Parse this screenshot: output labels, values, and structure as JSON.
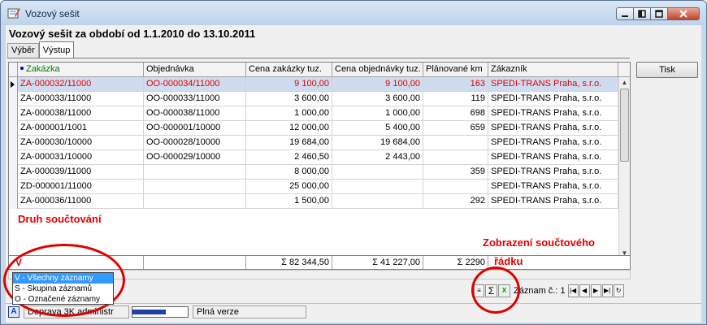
{
  "window": {
    "title": "Vozový sešit",
    "heading": "Vozový sešit za období od 1.1.2010 do 13.10.2011"
  },
  "tabs": [
    {
      "label": "Výběr",
      "active": false
    },
    {
      "label": "Výstup",
      "active": true
    }
  ],
  "grid": {
    "columns": [
      "Zakázka",
      "Objednávka",
      "Cena zakázky tuz.",
      "Cena objednávky tuz.",
      "Plánované km",
      "Zákazník"
    ],
    "rows": [
      {
        "zakazka": "ZA-000032/11000",
        "objednavka": "OO-000034/11000",
        "cena_zak": "9 100,00",
        "cena_obj": "9 100,00",
        "km": "163",
        "zakaznik": "SPEDI-TRANS Praha, s.r.o.",
        "selected": true
      },
      {
        "zakazka": "ZA-000033/11000",
        "objednavka": "OO-000033/11000",
        "cena_zak": "3 600,00",
        "cena_obj": "3 600,00",
        "km": "119",
        "zakaznik": "SPEDI-TRANS Praha, s.r.o.",
        "selected": false
      },
      {
        "zakazka": "ZA-000038/11000",
        "objednavka": "OO-000038/11000",
        "cena_zak": "1 000,00",
        "cena_obj": "1 000,00",
        "km": "698",
        "zakaznik": "SPEDI-TRANS Praha, s.r.o.",
        "selected": false
      },
      {
        "zakazka": "ZA-000001/1001",
        "objednavka": "OO-000001/10000",
        "cena_zak": "12 000,00",
        "cena_obj": "5 400,00",
        "km": "659",
        "zakaznik": "SPEDI-TRANS Praha, s.r.o.",
        "selected": false
      },
      {
        "zakazka": "ZA-000030/10000",
        "objednavka": "OO-000028/10000",
        "cena_zak": "19 684,00",
        "cena_obj": "19 684,00",
        "km": "",
        "zakaznik": "SPEDI-TRANS Praha, s.r.o.",
        "selected": false
      },
      {
        "zakazka": "ZA-000031/10000",
        "objednavka": "OO-000029/10000",
        "cena_zak": "2 460,50",
        "cena_obj": "2 443,00",
        "km": "",
        "zakaznik": "SPEDI-TRANS Praha, s.r.o.",
        "selected": false
      },
      {
        "zakazka": "ZA-000039/11000",
        "objednavka": "",
        "cena_zak": "8 000,00",
        "cena_obj": "",
        "km": "359",
        "zakaznik": "SPEDI-TRANS Praha, s.r.o.",
        "selected": false
      },
      {
        "zakazka": "ZD-000001/11000",
        "objednavka": "",
        "cena_zak": "25 000,00",
        "cena_obj": "",
        "km": "",
        "zakaznik": "SPEDI-TRANS Praha, s.r.o.",
        "selected": false
      },
      {
        "zakazka": "ZA-000036/11000",
        "objednavka": "",
        "cena_zak": "1 500,00",
        "cena_obj": "",
        "km": "292",
        "zakaznik": "SPEDI-TRANS Praha, s.r.o.",
        "selected": false
      }
    ]
  },
  "sum_row": {
    "type_code": "V",
    "cena_zak": "Σ  82 344,50",
    "cena_obj": "Σ  41 227,00",
    "km": "Σ  2290"
  },
  "sum_type_options": [
    {
      "label": "V - Všechny záznamy",
      "selected": true
    },
    {
      "label": "S - Skupina záznamů",
      "selected": false
    },
    {
      "label": "O - Označené záznamy",
      "selected": false
    }
  ],
  "buttons": {
    "print": "Tisk"
  },
  "navigation": {
    "record_label": "Záznam č.: 1",
    "sigma": "Σ",
    "excel": "X",
    "first": "|◀",
    "prev": "◀",
    "next": "▶",
    "last": "▶|",
    "refresh": "↻"
  },
  "status": {
    "badge": "A",
    "user": "Doprava 3K administr",
    "version": "Plná verze"
  },
  "annotations": {
    "sum_type": "Druh součtování",
    "sum_row_display_line1": "Zobrazení součtového",
    "sum_row_display_line2": "řádku"
  },
  "colors": {
    "annotation": "#e00000",
    "selected_row": "#cfdcf0",
    "dropdown_selected": "#3399ff"
  }
}
